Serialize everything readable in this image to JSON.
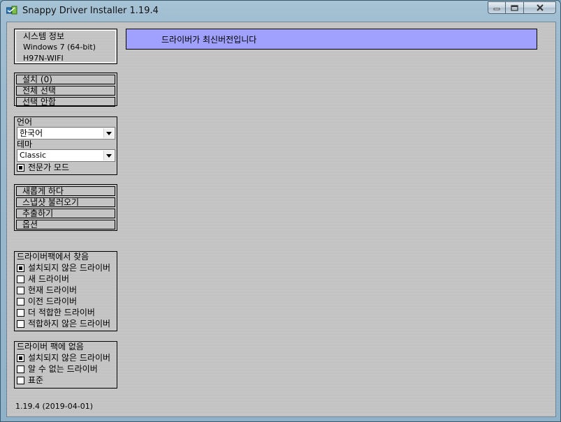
{
  "window": {
    "title": "Snappy Driver Installer 1.19.4",
    "icon": "sdi-app-icon"
  },
  "sysinfo": {
    "title": "시스템 정보",
    "os": "Windows 7 (64-bit)",
    "board": "H97N-WIFI"
  },
  "actions": {
    "install": "설치 (0)",
    "select_all": "전체 선택",
    "select_none": "선택 안함"
  },
  "settings": {
    "language_label": "언어",
    "language_value": "한국어",
    "theme_label": "테마",
    "theme_value": "Classic",
    "expert_label": "전문가 모드",
    "expert_checked": true
  },
  "tools": {
    "refresh": "새롭게 하다",
    "load_snapshot": "스냅샷 불러오기",
    "extract": "추출하기",
    "options": "옵션"
  },
  "found_filters": {
    "title": "드라이버팩에서 찾음",
    "items": [
      {
        "label": "설치되지 않은 드라이버",
        "checked": true
      },
      {
        "label": "새 드라이버",
        "checked": false
      },
      {
        "label": "현재 드라이버",
        "checked": false
      },
      {
        "label": "이전 드라이버",
        "checked": false
      },
      {
        "label": "더 적합한 드라이버",
        "checked": false
      },
      {
        "label": "적합하지 않은 드라이버",
        "checked": false
      }
    ]
  },
  "notfound_filters": {
    "title": "드라이버 팩에 없음",
    "items": [
      {
        "label": "설치되지 않은 드라이버",
        "checked": true
      },
      {
        "label": "알 수 없는 드라이버",
        "checked": false
      },
      {
        "label": "표준",
        "checked": false
      }
    ]
  },
  "status": {
    "message": "드라이버가 최신버전입니다"
  },
  "footer": {
    "version": "1.19.4 (2019-04-01)"
  }
}
